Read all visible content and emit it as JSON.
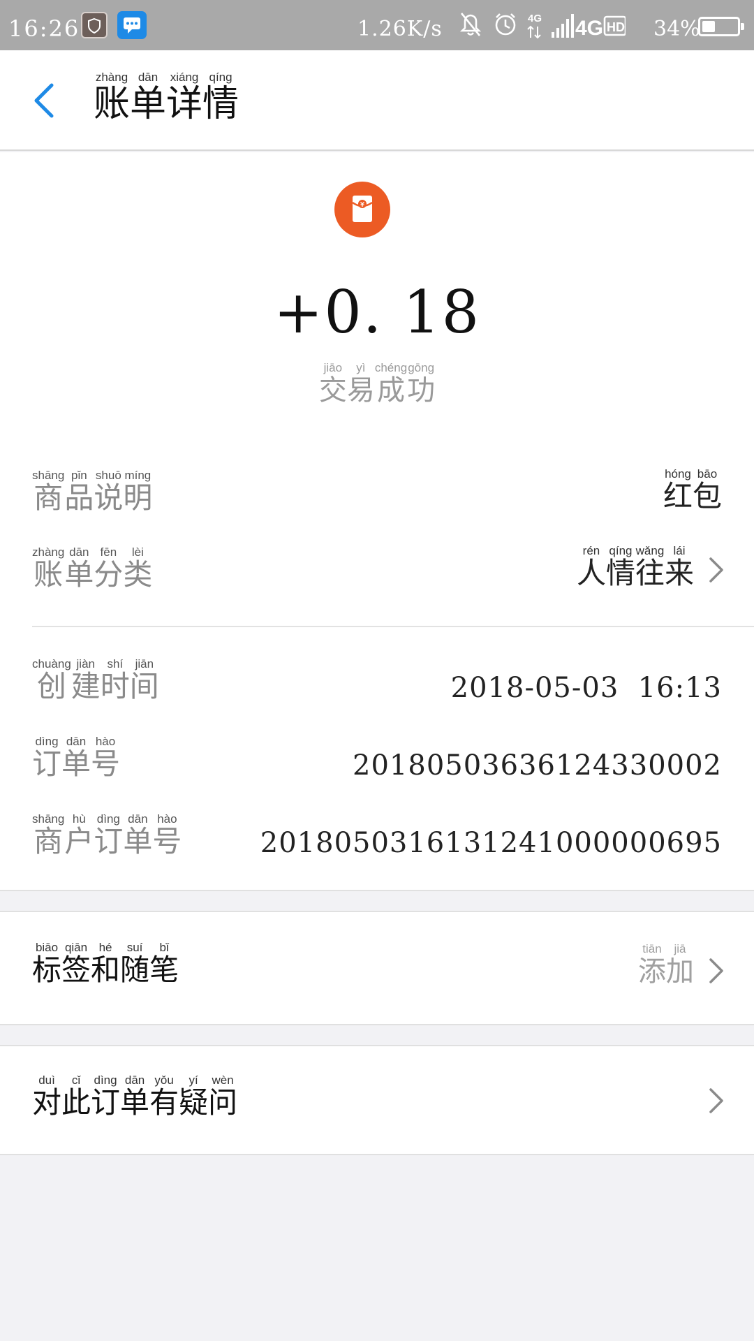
{
  "status_bar": {
    "time": "16:26",
    "network_speed": "1.26K/s",
    "battery_percent": "34%",
    "battery_level": 0.34,
    "icons": [
      "security-app-icon",
      "message-app-icon",
      "muted-bell-icon",
      "alarm-icon",
      "data-4g-icon",
      "signal-icon",
      "network-4g-icon",
      "hd-icon",
      "battery-icon"
    ],
    "labels": {
      "net_small": "4G",
      "net": "4G",
      "hd": "HD"
    }
  },
  "header": {
    "title": "账单详情",
    "title_pinyin": [
      "zhàng",
      "dān",
      "xiáng",
      "qíng"
    ]
  },
  "summary": {
    "icon": "hongbao-icon",
    "icon_color": "#ec5b24",
    "amount": "+0. 18",
    "status": "交易成功",
    "status_pinyin": [
      "jiāo",
      "yì",
      "chéng",
      "gōng"
    ]
  },
  "details": {
    "product": {
      "label": "商品说明",
      "label_pinyin": [
        "shāng",
        "pǐn",
        "shuō",
        "míng"
      ],
      "value": "红包",
      "value_pinyin": [
        "hóng",
        "bāo"
      ]
    },
    "category": {
      "label": "账单分类",
      "label_pinyin": [
        "zhàng",
        "dān",
        "fēn",
        "lèi"
      ],
      "value": "人情往来",
      "value_pinyin": [
        "rén",
        "qíng",
        "wǎng",
        "lái"
      ]
    },
    "created_time": {
      "label": "创建时间",
      "label_pinyin": [
        "chuàng",
        "jiàn",
        "shí",
        "jiān"
      ],
      "value": "2018-05-03  16:13"
    },
    "order_no": {
      "label": "订单号",
      "label_pinyin": [
        "dìng",
        "dān",
        "hào"
      ],
      "value": "20180503636124330002"
    },
    "merchant_order_no": {
      "label": "商户订单号",
      "label_pinyin": [
        "shāng",
        "hù",
        "dìng",
        "dān",
        "hào"
      ],
      "value": "2018050316131241000000695"
    }
  },
  "tags": {
    "label": "标签和随笔",
    "label_pinyin": [
      "biāo",
      "qiān",
      "hé",
      "suí",
      "bǐ"
    ],
    "action": "添加",
    "action_pinyin": [
      "tiān",
      "jiā"
    ]
  },
  "question": {
    "label": "对此订单有疑问",
    "label_pinyin": [
      "duì",
      "cǐ",
      "dìng",
      "dān",
      "yǒu",
      "yí",
      "wèn"
    ]
  },
  "colors": {
    "accent_blue": "#1e8ae6",
    "status_bar_bg": "#a9a9a9",
    "page_bg": "#f2f2f5"
  }
}
